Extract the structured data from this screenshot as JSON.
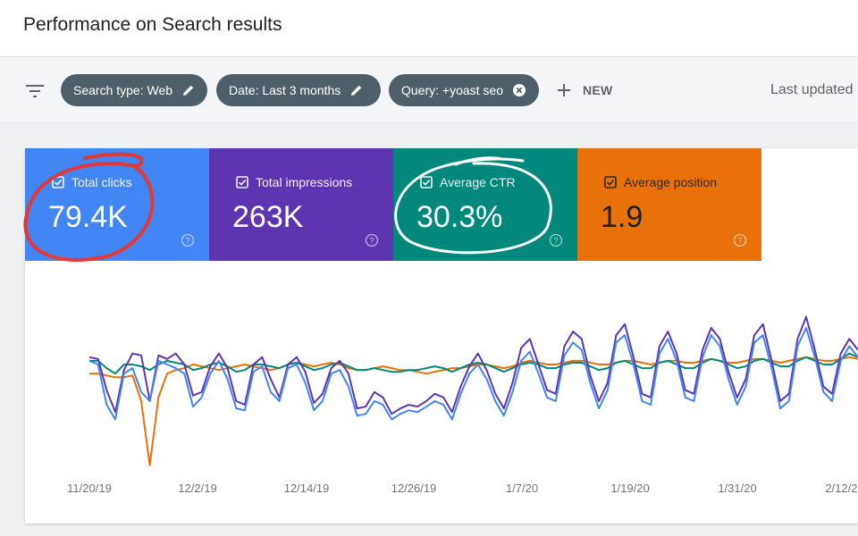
{
  "header": {
    "title": "Performance on Search results"
  },
  "filters": {
    "chips": [
      {
        "label": "Search type: Web",
        "icon": "pencil-icon"
      },
      {
        "label": "Date: Last 3 months",
        "icon": "pencil-icon"
      },
      {
        "label": "Query: +yoast seo",
        "icon": "close-circle-icon"
      }
    ],
    "new_label": "NEW",
    "last_updated": "Last updated"
  },
  "metrics": [
    {
      "label": "Total clicks",
      "value": "79.4K",
      "color": "#4285f4"
    },
    {
      "label": "Total impressions",
      "value": "263K",
      "color": "#5e35b1"
    },
    {
      "label": "Average CTR",
      "value": "30.3%",
      "color": "#00897b"
    },
    {
      "label": "Average position",
      "value": "1.9",
      "color": "#e8710a"
    }
  ],
  "chart_data": {
    "type": "line",
    "x_ticks": [
      "11/20/19",
      "12/2/19",
      "12/14/19",
      "12/26/19",
      "1/7/20",
      "1/19/20",
      "1/31/20",
      "2/12/20"
    ],
    "series": [
      {
        "name": "Total clicks",
        "color": "#4285f4",
        "values": [
          0.62,
          0.6,
          0.38,
          0.3,
          0.55,
          0.58,
          0.45,
          0.4,
          0.62,
          0.6,
          0.58,
          0.55,
          0.37,
          0.42,
          0.55,
          0.62,
          0.52,
          0.36,
          0.35,
          0.56,
          0.59,
          0.45,
          0.4,
          0.58,
          0.6,
          0.5,
          0.35,
          0.4,
          0.55,
          0.57,
          0.48,
          0.32,
          0.33,
          0.4,
          0.38,
          0.3,
          0.33,
          0.35,
          0.34,
          0.37,
          0.4,
          0.38,
          0.3,
          0.44,
          0.55,
          0.6,
          0.52,
          0.4,
          0.32,
          0.45,
          0.62,
          0.67,
          0.55,
          0.42,
          0.4,
          0.65,
          0.72,
          0.68,
          0.5,
          0.36,
          0.46,
          0.72,
          0.76,
          0.6,
          0.4,
          0.38,
          0.66,
          0.74,
          0.62,
          0.42,
          0.4,
          0.64,
          0.76,
          0.7,
          0.52,
          0.38,
          0.48,
          0.72,
          0.76,
          0.58,
          0.36,
          0.4,
          0.7,
          0.8,
          0.64,
          0.45,
          0.4,
          0.62,
          0.7,
          0.64
        ]
      },
      {
        "name": "Total impressions",
        "color": "#5e35b1",
        "values": [
          0.64,
          0.63,
          0.46,
          0.34,
          0.57,
          0.66,
          0.65,
          0.4,
          0.65,
          0.63,
          0.66,
          0.6,
          0.43,
          0.45,
          0.59,
          0.66,
          0.58,
          0.4,
          0.38,
          0.6,
          0.64,
          0.52,
          0.42,
          0.6,
          0.64,
          0.56,
          0.39,
          0.44,
          0.58,
          0.62,
          0.55,
          0.36,
          0.37,
          0.45,
          0.42,
          0.33,
          0.36,
          0.38,
          0.37,
          0.4,
          0.44,
          0.42,
          0.34,
          0.48,
          0.59,
          0.66,
          0.57,
          0.44,
          0.36,
          0.5,
          0.69,
          0.74,
          0.6,
          0.46,
          0.44,
          0.7,
          0.78,
          0.74,
          0.54,
          0.4,
          0.5,
          0.76,
          0.82,
          0.64,
          0.44,
          0.42,
          0.7,
          0.78,
          0.66,
          0.46,
          0.44,
          0.68,
          0.8,
          0.74,
          0.56,
          0.42,
          0.52,
          0.76,
          0.82,
          0.62,
          0.4,
          0.44,
          0.74,
          0.86,
          0.68,
          0.48,
          0.44,
          0.66,
          0.74,
          0.68
        ]
      },
      {
        "name": "Average CTR",
        "color": "#00897b",
        "values": [
          0.62,
          0.62,
          0.58,
          0.55,
          0.6,
          0.6,
          0.59,
          0.57,
          0.6,
          0.62,
          0.61,
          0.6,
          0.57,
          0.58,
          0.6,
          0.61,
          0.59,
          0.56,
          0.57,
          0.6,
          0.6,
          0.59,
          0.58,
          0.6,
          0.61,
          0.59,
          0.57,
          0.58,
          0.6,
          0.61,
          0.59,
          0.57,
          0.57,
          0.58,
          0.57,
          0.56,
          0.56,
          0.57,
          0.57,
          0.58,
          0.59,
          0.58,
          0.56,
          0.58,
          0.6,
          0.61,
          0.6,
          0.58,
          0.56,
          0.58,
          0.6,
          0.61,
          0.6,
          0.58,
          0.58,
          0.6,
          0.61,
          0.61,
          0.59,
          0.57,
          0.58,
          0.61,
          0.62,
          0.6,
          0.58,
          0.58,
          0.61,
          0.62,
          0.6,
          0.58,
          0.58,
          0.61,
          0.63,
          0.62,
          0.6,
          0.58,
          0.59,
          0.62,
          0.63,
          0.61,
          0.59,
          0.59,
          0.62,
          0.64,
          0.62,
          0.6,
          0.6,
          0.63,
          0.66,
          0.64
        ]
      },
      {
        "name": "Average position",
        "color": "#e8710a",
        "values": [
          0.55,
          0.55,
          0.54,
          0.53,
          0.53,
          0.54,
          0.4,
          0.05,
          0.42,
          0.55,
          0.57,
          0.58,
          0.6,
          0.59,
          0.58,
          0.57,
          0.58,
          0.59,
          0.6,
          0.59,
          0.58,
          0.57,
          0.58,
          0.6,
          0.61,
          0.6,
          0.59,
          0.6,
          0.61,
          0.6,
          0.58,
          0.57,
          0.57,
          0.58,
          0.59,
          0.58,
          0.57,
          0.57,
          0.56,
          0.55,
          0.56,
          0.57,
          0.58,
          0.58,
          0.59,
          0.6,
          0.6,
          0.59,
          0.58,
          0.59,
          0.61,
          0.62,
          0.61,
          0.6,
          0.6,
          0.61,
          0.62,
          0.62,
          0.61,
          0.6,
          0.6,
          0.61,
          0.62,
          0.62,
          0.61,
          0.6,
          0.61,
          0.62,
          0.62,
          0.61,
          0.61,
          0.62,
          0.63,
          0.62,
          0.61,
          0.61,
          0.62,
          0.63,
          0.63,
          0.62,
          0.61,
          0.62,
          0.63,
          0.64,
          0.63,
          0.62,
          0.62,
          0.63,
          0.64,
          0.63
        ]
      }
    ]
  }
}
